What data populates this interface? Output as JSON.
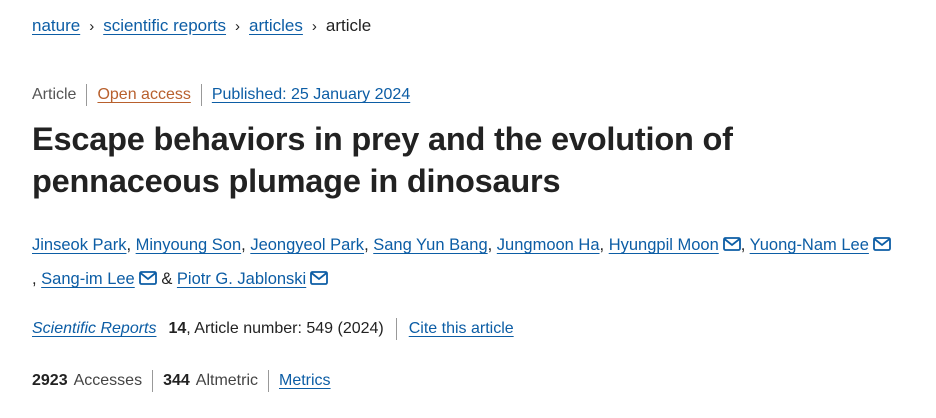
{
  "breadcrumb": {
    "items": [
      "nature",
      "scientific reports",
      "articles",
      "article"
    ],
    "separator": "›"
  },
  "meta": {
    "type": "Article",
    "access": "Open access",
    "published": "Published: 25 January 2024"
  },
  "title": {
    "line1": "Escape behaviors in prey and the evolution of",
    "line2": "pennaceous plumage in dinosaurs"
  },
  "authors": [
    {
      "name": "Jinseok Park",
      "email": false,
      "after": ", "
    },
    {
      "name": "Minyoung Son",
      "email": false,
      "after": ", "
    },
    {
      "name": "Jeongyeol Park",
      "email": false,
      "after": ", "
    },
    {
      "name": "Sang Yun Bang",
      "email": false,
      "after": ", "
    },
    {
      "name": "Jungmoon Ha",
      "email": false,
      "after": ", "
    },
    {
      "name": "Hyungpil Moon",
      "email": true,
      "after": ", "
    },
    {
      "name": "Yuong-Nam Lee",
      "email": true,
      "after": ", "
    },
    {
      "name": "Sang-im Lee",
      "email": true,
      "after": " & "
    },
    {
      "name": "Piotr G. Jablonski",
      "email": true,
      "after": ""
    }
  ],
  "citation": {
    "journal": "Scientific Reports",
    "volume": "14",
    "details": ", Article number: 549 (2024)",
    "cite_link": "Cite this article"
  },
  "metrics": {
    "accesses_count": "2923",
    "accesses_label": "Accesses",
    "altmetric_count": "344",
    "altmetric_label": "Altmetric",
    "metrics_link": "Metrics"
  },
  "icons": {
    "email": "mail-icon",
    "separator": "chevron-right-icon"
  },
  "colors": {
    "link": "#0c5da5",
    "open_access": "#b8602d",
    "text": "#222222"
  }
}
